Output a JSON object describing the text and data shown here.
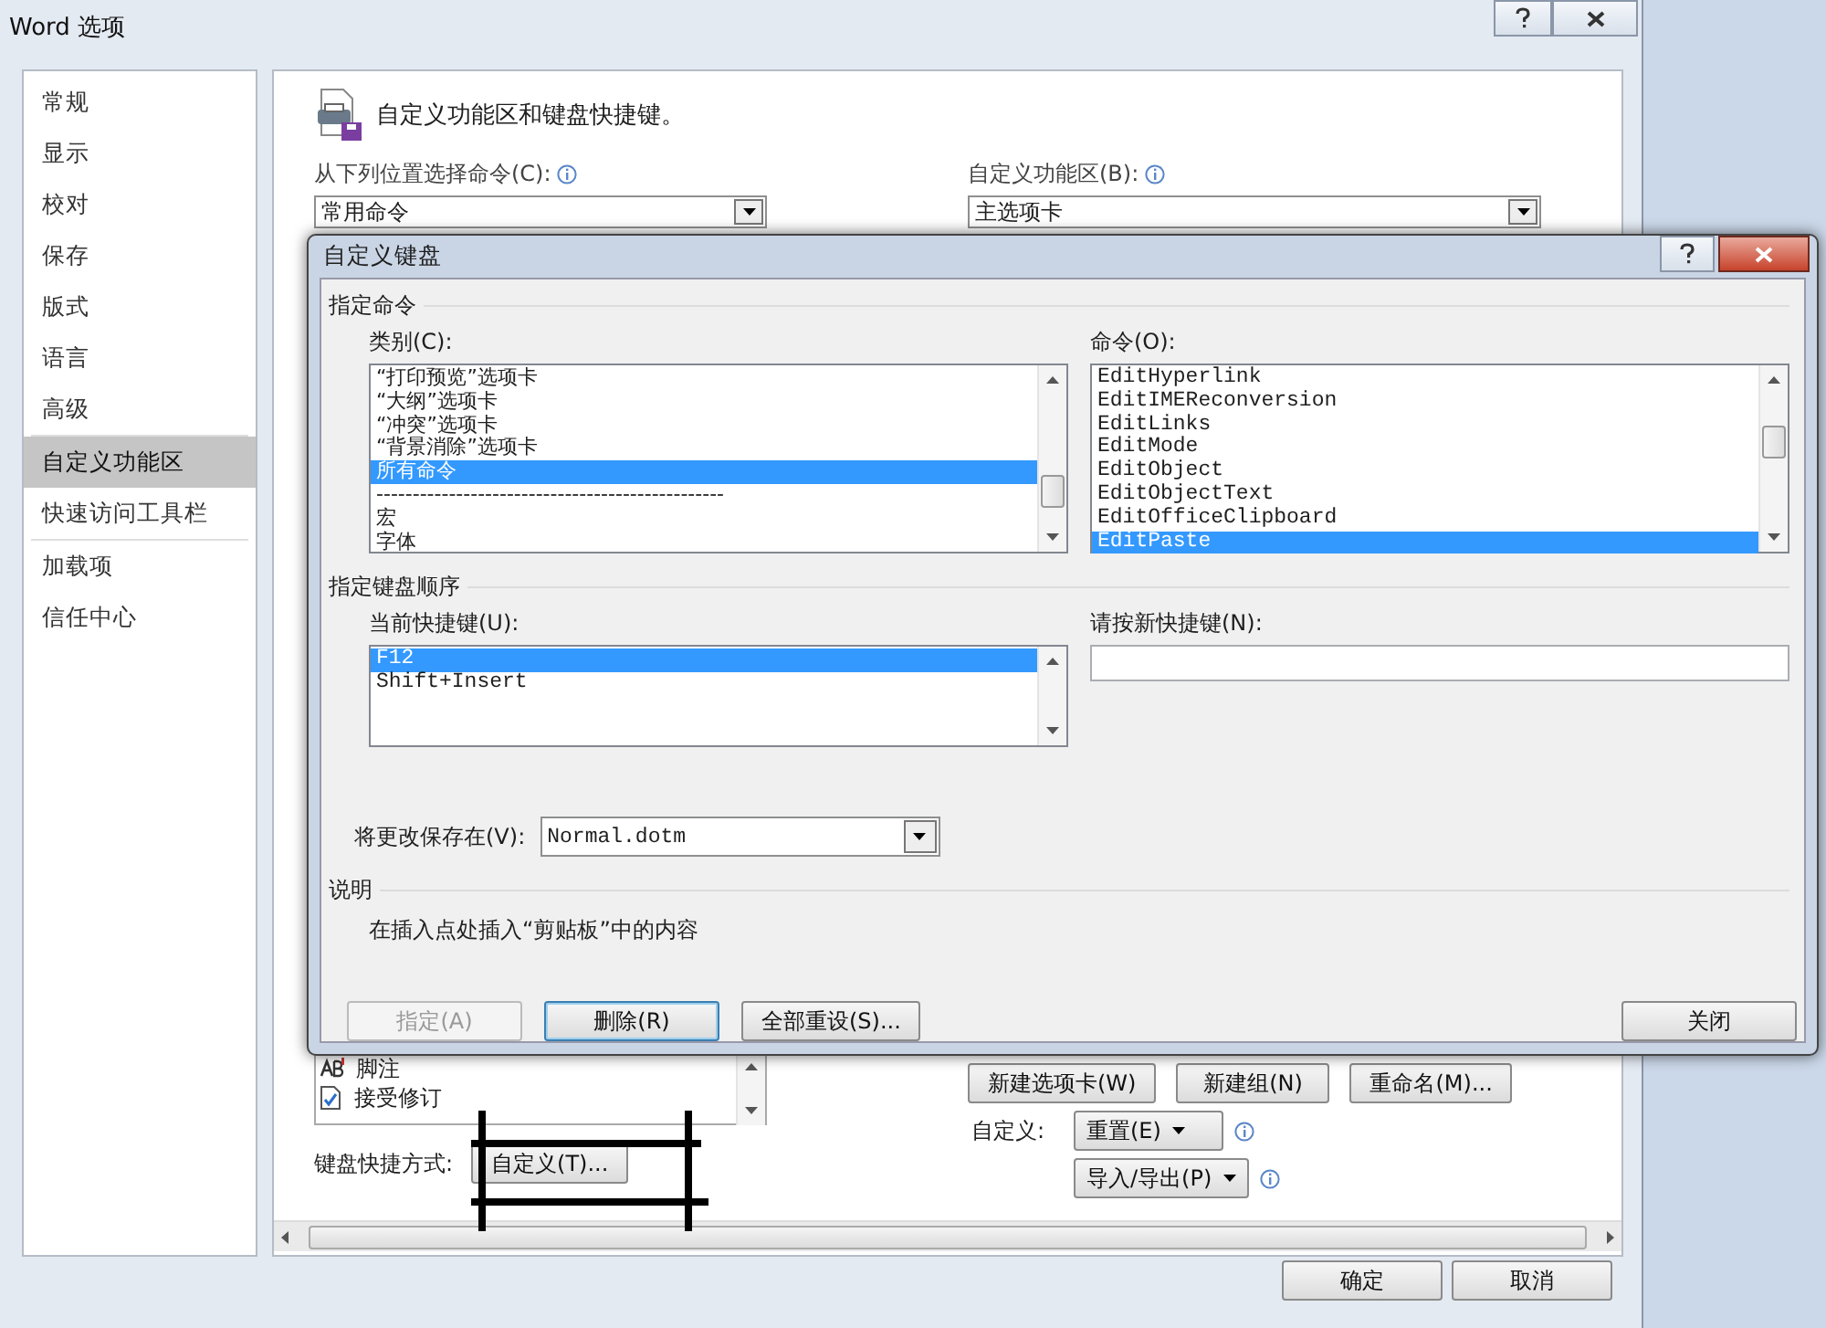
{
  "window": {
    "title": "Word 选项"
  },
  "sidebar": {
    "items": [
      {
        "label": "常规",
        "selected": false,
        "separator_after": false
      },
      {
        "label": "显示",
        "selected": false,
        "separator_after": false
      },
      {
        "label": "校对",
        "selected": false,
        "separator_after": false
      },
      {
        "label": "保存",
        "selected": false,
        "separator_after": false
      },
      {
        "label": "版式",
        "selected": false,
        "separator_after": false
      },
      {
        "label": "语言",
        "selected": false,
        "separator_after": false
      },
      {
        "label": "高级",
        "selected": false,
        "separator_after": true
      },
      {
        "label": "自定义功能区",
        "selected": true,
        "separator_after": false
      },
      {
        "label": "快速访问工具栏",
        "selected": false,
        "separator_after": true
      },
      {
        "label": "加载项",
        "selected": false,
        "separator_after": false
      },
      {
        "label": "信任中心",
        "selected": false,
        "separator_after": false
      }
    ]
  },
  "main": {
    "heading": "自定义功能区和键盘快捷键。",
    "choose_commands": {
      "label": "从下列位置选择命令(C):",
      "value": "常用命令"
    },
    "customize_ribbon": {
      "label": "自定义功能区(B):",
      "value": "主选项卡"
    },
    "command_list": {
      "items": [
        {
          "label": "脚注"
        },
        {
          "label": "接受修订"
        }
      ]
    },
    "keyboard_shortcuts": {
      "label": "键盘快捷方式:",
      "button": "自定义(T)..."
    },
    "tab_buttons": [
      {
        "label": "新建选项卡(W)"
      },
      {
        "label": "新建组(N)"
      },
      {
        "label": "重命名(M)..."
      }
    ],
    "customizations": {
      "label": "自定义:",
      "reset": "重置(E)",
      "import_export": "导入/导出(P)"
    }
  },
  "buttons": [
    {
      "label": "确定"
    },
    {
      "label": "取消"
    }
  ],
  "dialog": {
    "title": "自定义键盘",
    "specify_command": {
      "heading": "指定命令",
      "categories": {
        "label": "类别(C):",
        "items": [
          {
            "label": "“打印预览”选项卡",
            "selected": false
          },
          {
            "label": "“大纲”选项卡",
            "selected": false
          },
          {
            "label": "“冲突”选项卡",
            "selected": false
          },
          {
            "label": "“背景消除”选项卡",
            "selected": false
          },
          {
            "label": "所有命令",
            "selected": true
          },
          {
            "label": "------------------------------------------------",
            "selected": false
          },
          {
            "label": "宏",
            "selected": false
          },
          {
            "label": "字体",
            "selected": false
          }
        ]
      },
      "commands": {
        "label": "命令(O):",
        "items": [
          {
            "label": "EditHyperlink",
            "selected": false
          },
          {
            "label": "EditIMEReconversion",
            "selected": false
          },
          {
            "label": "EditLinks",
            "selected": false
          },
          {
            "label": "EditMode",
            "selected": false
          },
          {
            "label": "EditObject",
            "selected": false
          },
          {
            "label": "EditObjectText",
            "selected": false
          },
          {
            "label": "EditOfficeClipboard",
            "selected": false
          },
          {
            "label": "EditPaste",
            "selected": true
          }
        ]
      }
    },
    "keyboard_sequence": {
      "heading": "指定键盘顺序",
      "current_keys": {
        "label": "当前快捷键(U):",
        "items": [
          {
            "label": "F12",
            "selected": true
          },
          {
            "label": "Shift+Insert",
            "selected": false
          }
        ]
      },
      "new_key": {
        "label": "请按新快捷键(N):"
      }
    },
    "save_changes_in": {
      "label": "将更改保存在(V):",
      "value": "Normal.dotm"
    },
    "description": {
      "heading": "说明",
      "text": "在插入点处插入“剪贴板”中的内容"
    },
    "buttons": [
      {
        "label": "指定(A)",
        "disabled": true,
        "focused": false
      },
      {
        "label": "删除(R)",
        "disabled": false,
        "focused": true
      },
      {
        "label": "全部重设(S)...",
        "disabled": false,
        "focused": false
      },
      {
        "label": "关闭",
        "disabled": false,
        "focused": false
      }
    ]
  }
}
